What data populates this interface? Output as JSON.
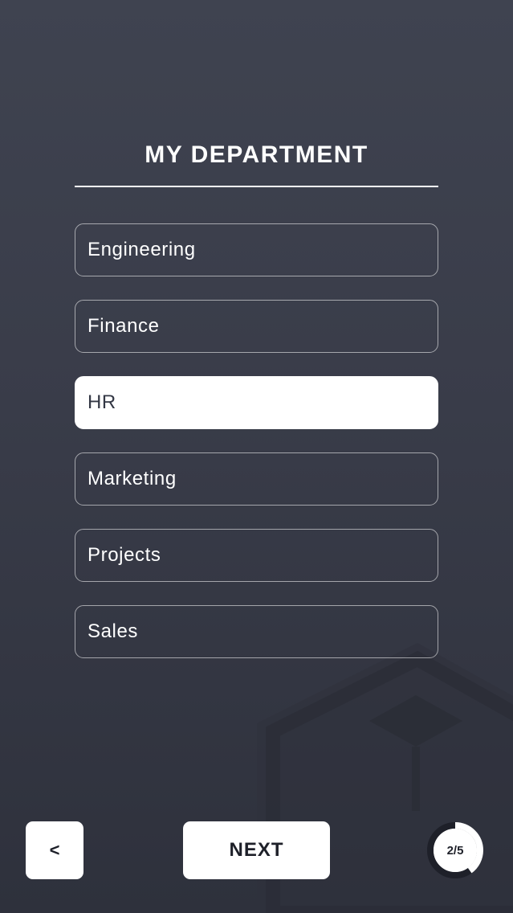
{
  "header": {
    "title": "MY DEPARTMENT"
  },
  "departments": {
    "items": [
      {
        "label": "Engineering",
        "selected": false
      },
      {
        "label": "Finance",
        "selected": false
      },
      {
        "label": "HR",
        "selected": true
      },
      {
        "label": "Marketing",
        "selected": false
      },
      {
        "label": "Projects",
        "selected": false
      },
      {
        "label": "Sales",
        "selected": false
      }
    ]
  },
  "footer": {
    "back_label": "<",
    "next_label": "NEXT",
    "progress_label": "2/5",
    "progress_current": 2,
    "progress_total": 5
  },
  "colors": {
    "background_top": "#3f4350",
    "background_bottom": "#2e313c",
    "selected_bg": "#ffffff",
    "selected_text": "#333744",
    "progress_track": "#1e2029",
    "progress_fill": "#ffffff"
  }
}
